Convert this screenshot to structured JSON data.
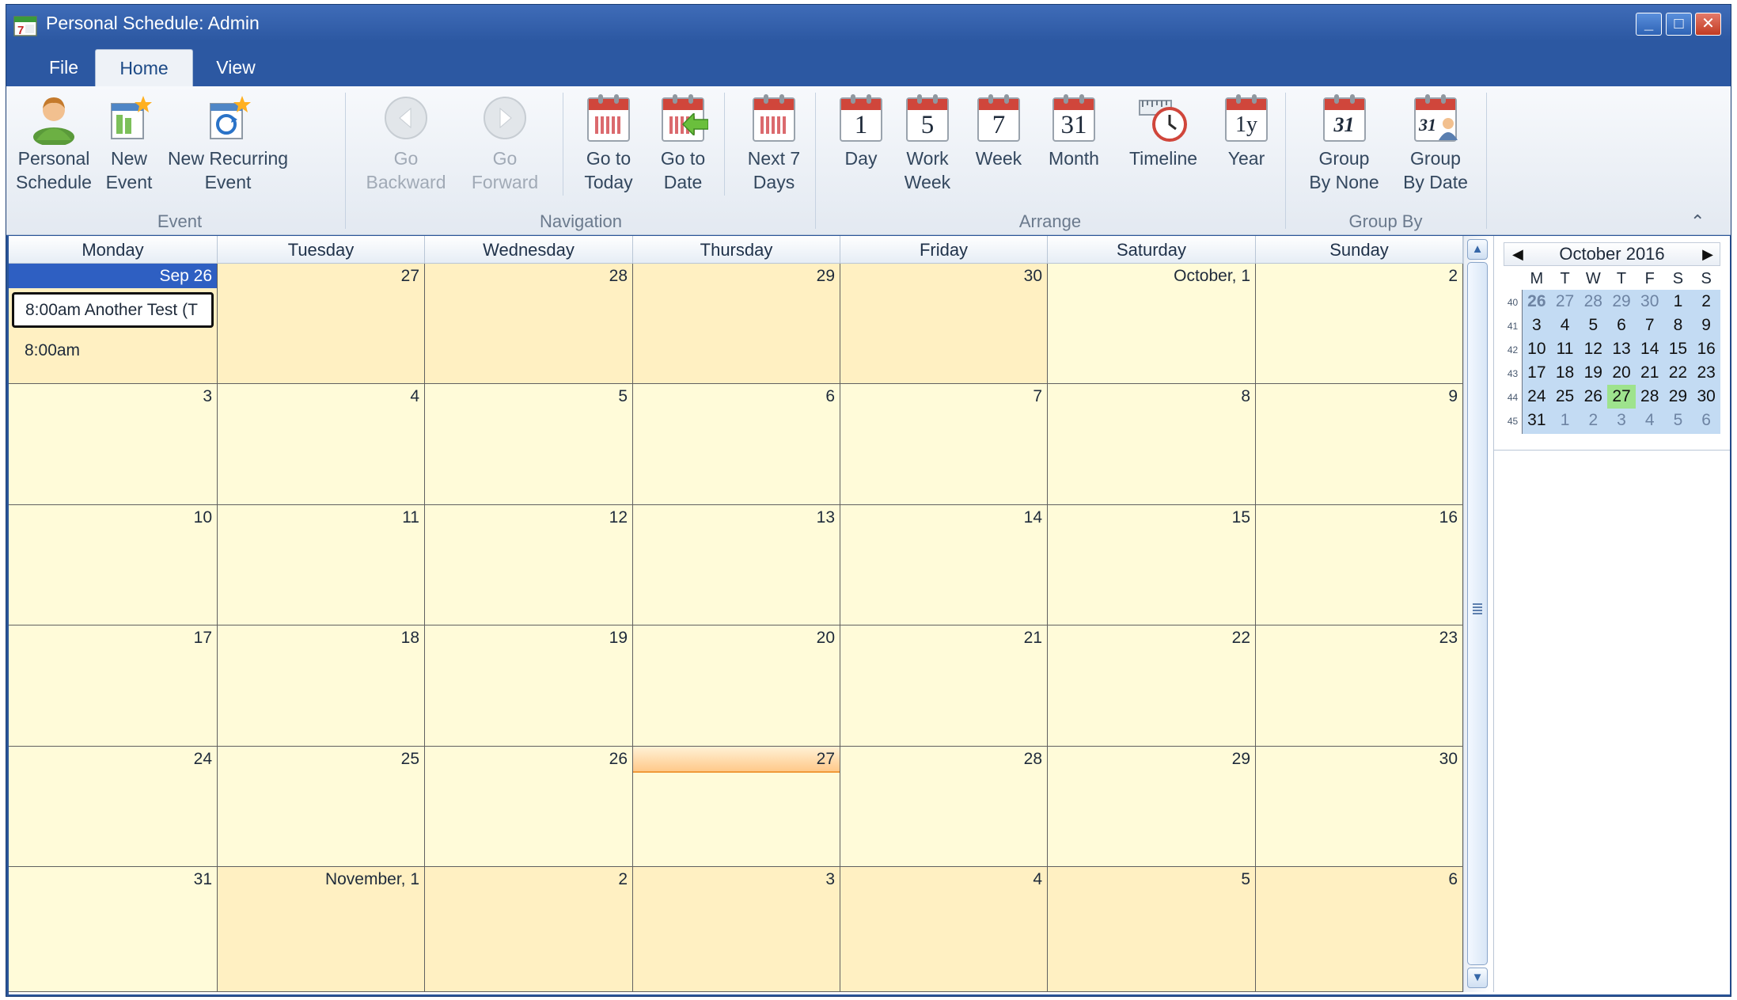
{
  "window": {
    "title": "Personal Schedule: Admin",
    "min": "_",
    "max": "□",
    "close": "✕"
  },
  "tabs": [
    "File",
    "Home",
    "View"
  ],
  "ribbon": {
    "groups": {
      "event": "Event",
      "navigation": "Navigation",
      "arrange": "Arrange",
      "group_by": "Group By"
    },
    "buttons": {
      "personal_schedule": "Personal\nSchedule",
      "new_event": "New\nEvent",
      "new_recurring_event": "New Recurring\nEvent",
      "go_backward": "Go\nBackward",
      "go_forward": "Go\nForward",
      "go_to_today": "Go to\nToday",
      "go_to_date": "Go to\nDate",
      "next_7_days": "Next 7\nDays",
      "day": "Day",
      "work_week": "Work\nWeek",
      "week": "Week",
      "month": "Month",
      "timeline": "Timeline",
      "year": "Year",
      "group_by_none": "Group\nBy None",
      "group_by_date": "Group\nBy Date"
    },
    "icon_numbers": {
      "day": "1",
      "work_week": "5",
      "week": "7",
      "month": "31",
      "year": "1y",
      "group_none": "31",
      "group_date": "31"
    },
    "collapse": "⌃"
  },
  "calendar": {
    "day_headers": [
      "Monday",
      "Tuesday",
      "Wednesday",
      "Thursday",
      "Friday",
      "Saturday",
      "Sunday"
    ],
    "weeks": [
      [
        "Sep 26",
        "27",
        "28",
        "29",
        "30",
        "October, 1",
        "2"
      ],
      [
        "3",
        "4",
        "5",
        "6",
        "7",
        "8",
        "9"
      ],
      [
        "10",
        "11",
        "12",
        "13",
        "14",
        "15",
        "16"
      ],
      [
        "17",
        "18",
        "19",
        "20",
        "21",
        "22",
        "23"
      ],
      [
        "24",
        "25",
        "26",
        "27",
        "28",
        "29",
        "30"
      ],
      [
        "31",
        "November, 1",
        "2",
        "3",
        "4",
        "5",
        "6"
      ]
    ],
    "events": {
      "first": "8:00am Another Test (T",
      "second": "8:00am"
    }
  },
  "scroll": {
    "up": "▲",
    "down": "▼"
  },
  "mini_calendar": {
    "month": "October 2016",
    "prev": "◀",
    "next": "▶",
    "dow": [
      "M",
      "T",
      "W",
      "T",
      "F",
      "S",
      "S"
    ],
    "weeks": [
      {
        "wk": "40",
        "days": [
          "26",
          "27",
          "28",
          "29",
          "30",
          "1",
          "2"
        ]
      },
      {
        "wk": "41",
        "days": [
          "3",
          "4",
          "5",
          "6",
          "7",
          "8",
          "9"
        ]
      },
      {
        "wk": "42",
        "days": [
          "10",
          "11",
          "12",
          "13",
          "14",
          "15",
          "16"
        ]
      },
      {
        "wk": "43",
        "days": [
          "17",
          "18",
          "19",
          "20",
          "21",
          "22",
          "23"
        ]
      },
      {
        "wk": "44",
        "days": [
          "24",
          "25",
          "26",
          "27",
          "28",
          "29",
          "30"
        ]
      },
      {
        "wk": "45",
        "days": [
          "31",
          "1",
          "2",
          "3",
          "4",
          "5",
          "6"
        ]
      }
    ]
  }
}
